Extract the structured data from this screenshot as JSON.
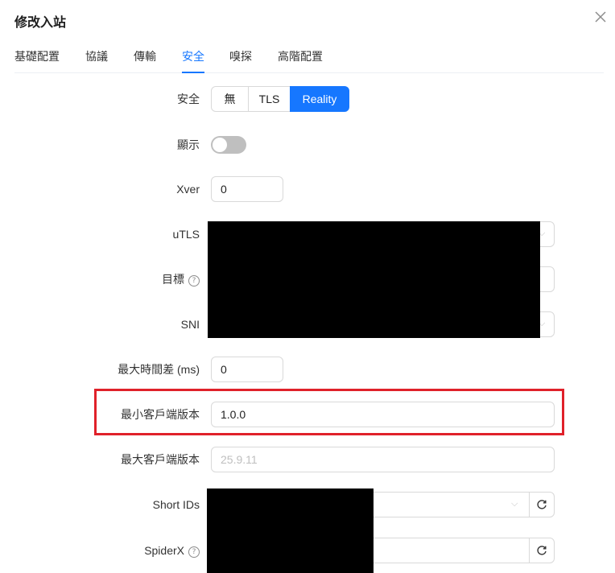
{
  "dialog": {
    "title": "修改入站"
  },
  "tabs": [
    {
      "label": "基礎配置"
    },
    {
      "label": "協議"
    },
    {
      "label": "傳輸"
    },
    {
      "label": "安全"
    },
    {
      "label": "嗅探"
    },
    {
      "label": "高階配置"
    }
  ],
  "active_tab": "安全",
  "form": {
    "security": {
      "label": "安全",
      "options": [
        "無",
        "TLS",
        "Reality"
      ],
      "selected": "Reality"
    },
    "show": {
      "label": "顯示",
      "checked": false
    },
    "xver": {
      "label": "Xver",
      "value": "0"
    },
    "utls": {
      "label": "uTLS"
    },
    "target": {
      "label": "目標"
    },
    "sni": {
      "label": "SNI"
    },
    "max_time_diff": {
      "label": "最大時間差 (ms)",
      "value": "0"
    },
    "min_client_ver": {
      "label": "最小客戶端版本",
      "value": "1.0.0"
    },
    "max_client_ver": {
      "label": "最大客戶端版本",
      "placeholder": "25.9.11"
    },
    "short_ids": {
      "label": "Short IDs"
    },
    "spiderx": {
      "label": "SpiderX"
    }
  },
  "colors": {
    "accent": "#1677ff",
    "highlight": "#e0212a",
    "redaction": "#000000"
  },
  "icons": {
    "close": "close-icon",
    "help": "question-circle-icon",
    "refresh": "reload-icon",
    "dropdown": "chevron-down-icon"
  }
}
